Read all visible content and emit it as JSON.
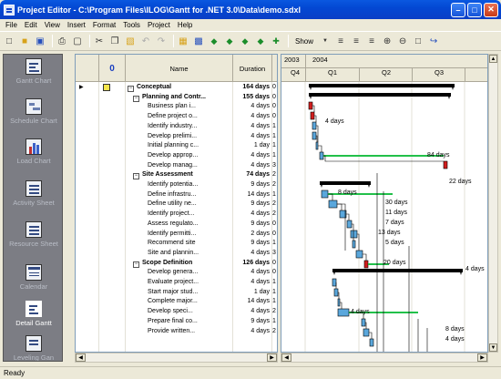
{
  "window": {
    "title": "Project Editor - C:\\Program Files\\ILOG\\Gantt for .NET 3.0\\Data\\demo.sdxl"
  },
  "menu": [
    "File",
    "Edit",
    "View",
    "Insert",
    "Format",
    "Tools",
    "Project",
    "Help"
  ],
  "toolbar": {
    "show_label": "Show",
    "icons": [
      "new-icon",
      "open-icon",
      "save-icon",
      "print-icon",
      "print-preview-icon",
      "cut-icon",
      "copy-icon",
      "paste-icon",
      "undo-icon",
      "redo-icon",
      "insert-task-icon",
      "task-info-icon",
      "move-up-icon",
      "move-down-icon",
      "move-left-icon",
      "move-right-icon",
      "indent-icon",
      "align-left-icon",
      "align-center-icon",
      "align-right-icon",
      "zoom-in-icon",
      "zoom-out-icon",
      "fit-icon",
      "goto-icon"
    ]
  },
  "outlook_bar": [
    {
      "label": "Gantt Chart",
      "icon": "gantt-chart-icon"
    },
    {
      "label": "Schedule Chart",
      "icon": "schedule-chart-icon"
    },
    {
      "label": "Load Chart",
      "icon": "load-chart-icon"
    },
    {
      "label": "Activity Sheet",
      "icon": "activity-sheet-icon"
    },
    {
      "label": "Resource Sheet",
      "icon": "resource-sheet-icon"
    },
    {
      "label": "Calendar",
      "icon": "calendar-icon"
    },
    {
      "label": "Detail Gantt",
      "icon": "detail-gantt-icon",
      "selected": true
    },
    {
      "label": "Leveling Gan",
      "icon": "leveling-gantt-icon"
    }
  ],
  "table": {
    "columns": {
      "info": "0",
      "name": "Name",
      "duration": "Duration"
    },
    "rows": [
      {
        "name": "Conceptual",
        "duration": "164 days",
        "x": "0",
        "level": 0,
        "summary": true,
        "selected": true,
        "note": true
      },
      {
        "name": "Planning and Contr...",
        "duration": "155 days",
        "x": "0",
        "level": 1,
        "summary": true
      },
      {
        "name": "Business plan i...",
        "duration": "4 days",
        "x": "0",
        "level": 2
      },
      {
        "name": "Define project o...",
        "duration": "4 days",
        "x": "0",
        "level": 2
      },
      {
        "name": "Identify industry...",
        "duration": "4 days",
        "x": "1",
        "level": 2
      },
      {
        "name": "Develop prelimi...",
        "duration": "4 days",
        "x": "1",
        "level": 2
      },
      {
        "name": "Initial planning c...",
        "duration": "1 day",
        "x": "1",
        "level": 2
      },
      {
        "name": "Develop approp...",
        "duration": "4 days",
        "x": "1",
        "level": 2
      },
      {
        "name": "Develop manag...",
        "duration": "4 days",
        "x": "3",
        "level": 2
      },
      {
        "name": "Site Assessment",
        "duration": "74 days",
        "x": "2",
        "level": 1,
        "summary": true
      },
      {
        "name": "Identify potentia...",
        "duration": "9 days",
        "x": "2",
        "level": 2
      },
      {
        "name": "Define infrastru...",
        "duration": "14 days",
        "x": "1",
        "level": 2
      },
      {
        "name": "Define utility ne...",
        "duration": "9 days",
        "x": "2",
        "level": 2
      },
      {
        "name": "Identify project...",
        "duration": "4 days",
        "x": "2",
        "level": 2
      },
      {
        "name": "Assess regulato...",
        "duration": "9 days",
        "x": "0",
        "level": 2
      },
      {
        "name": "Identify permitti...",
        "duration": "2 days",
        "x": "0",
        "level": 2
      },
      {
        "name": "Recommend site",
        "duration": "9 days",
        "x": "1",
        "level": 2
      },
      {
        "name": "Site and plannin...",
        "duration": "4 days",
        "x": "3",
        "level": 2
      },
      {
        "name": "Scope Definition",
        "duration": "126 days",
        "x": "0",
        "level": 1,
        "summary": true
      },
      {
        "name": "Develop genera...",
        "duration": "4 days",
        "x": "0",
        "level": 2
      },
      {
        "name": "Evaluate project...",
        "duration": "4 days",
        "x": "1",
        "level": 2
      },
      {
        "name": "Start major stud...",
        "duration": "1 day",
        "x": "1",
        "level": 2
      },
      {
        "name": "Complete major...",
        "duration": "14 days",
        "x": "1",
        "level": 2
      },
      {
        "name": "Develop speci...",
        "duration": "4 days",
        "x": "2",
        "level": 2
      },
      {
        "name": "Prepare final co...",
        "duration": "9 days",
        "x": "1",
        "level": 2
      },
      {
        "name": "Provide written...",
        "duration": "4 days",
        "x": "2",
        "level": 2
      }
    ]
  },
  "gantt": {
    "years": [
      "2003",
      "2004"
    ],
    "quarters": [
      "Q4",
      "Q1",
      "Q2",
      "Q3"
    ],
    "labels": [
      "4 days",
      "84 days",
      "22 days",
      "8 days",
      "30 days",
      "11 days",
      "7 days",
      "13 days",
      "5 days",
      "20 days",
      "4 days",
      "4 days",
      "8 days",
      "4 days"
    ]
  },
  "status": {
    "text": "Ready"
  }
}
